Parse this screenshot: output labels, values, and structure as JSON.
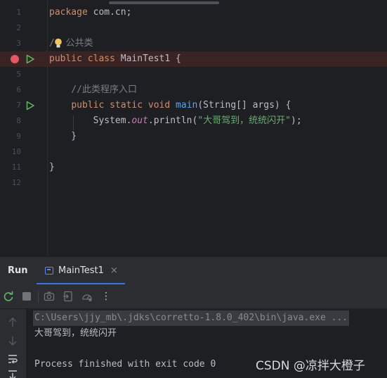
{
  "editor": {
    "lines": [
      {
        "num": "1",
        "segments": [
          {
            "t": "package",
            "c": "kw"
          },
          {
            "t": " com.cn;",
            "c": ""
          }
        ]
      },
      {
        "num": "2",
        "segments": []
      },
      {
        "num": "3",
        "segments": [
          {
            "t": "/",
            "c": "cm"
          },
          {
            "t": "  ",
            "c": "cm"
          },
          {
            "t": "公共类",
            "c": "cm"
          }
        ]
      },
      {
        "num": "",
        "segments": [
          {
            "t": "public",
            "c": "kw"
          },
          {
            "t": " ",
            "c": ""
          },
          {
            "t": "class",
            "c": "kw"
          },
          {
            "t": " MainTest1 {",
            "c": ""
          }
        ]
      },
      {
        "num": "5",
        "segments": []
      },
      {
        "num": "6",
        "segments": [
          {
            "t": "    //此类程序入口",
            "c": "cm"
          }
        ]
      },
      {
        "num": "7",
        "segments": [
          {
            "t": "    ",
            "c": ""
          },
          {
            "t": "public",
            "c": "kw"
          },
          {
            "t": " ",
            "c": ""
          },
          {
            "t": "static",
            "c": "kw"
          },
          {
            "t": " ",
            "c": ""
          },
          {
            "t": "void",
            "c": "kw"
          },
          {
            "t": " ",
            "c": ""
          },
          {
            "t": "main",
            "c": "fn"
          },
          {
            "t": "(String[] args) {",
            "c": ""
          }
        ]
      },
      {
        "num": "8",
        "segments": [
          {
            "t": "        System.",
            "c": ""
          },
          {
            "t": "out",
            "c": "fld"
          },
          {
            "t": ".println(",
            "c": ""
          },
          {
            "t": "\"大哥驾到，统统闪开\"",
            "c": "str"
          },
          {
            "t": ");",
            "c": ""
          }
        ]
      },
      {
        "num": "9",
        "segments": [
          {
            "t": "    }",
            "c": ""
          }
        ]
      },
      {
        "num": "10",
        "segments": []
      },
      {
        "num": "11",
        "segments": [
          {
            "t": "}",
            "c": ""
          }
        ]
      },
      {
        "num": "12",
        "segments": []
      }
    ]
  },
  "tool_window": {
    "title": "Run",
    "tab_label": "MainTest1",
    "tab_close": "×",
    "more": "⋮"
  },
  "console": {
    "command": "C:\\Users\\jjy_mb\\.jdks\\corretto-1.8.0_402\\bin\\java.exe ...",
    "output": "大哥驾到，统统闪开",
    "finished": "Process finished with exit code 0"
  },
  "watermark": "CSDN @凉拌大橙子",
  "colors": {
    "accent": "#3574f0",
    "breakpoint": "#e55765",
    "run": "#5fb865",
    "stop": "#6f737a"
  }
}
